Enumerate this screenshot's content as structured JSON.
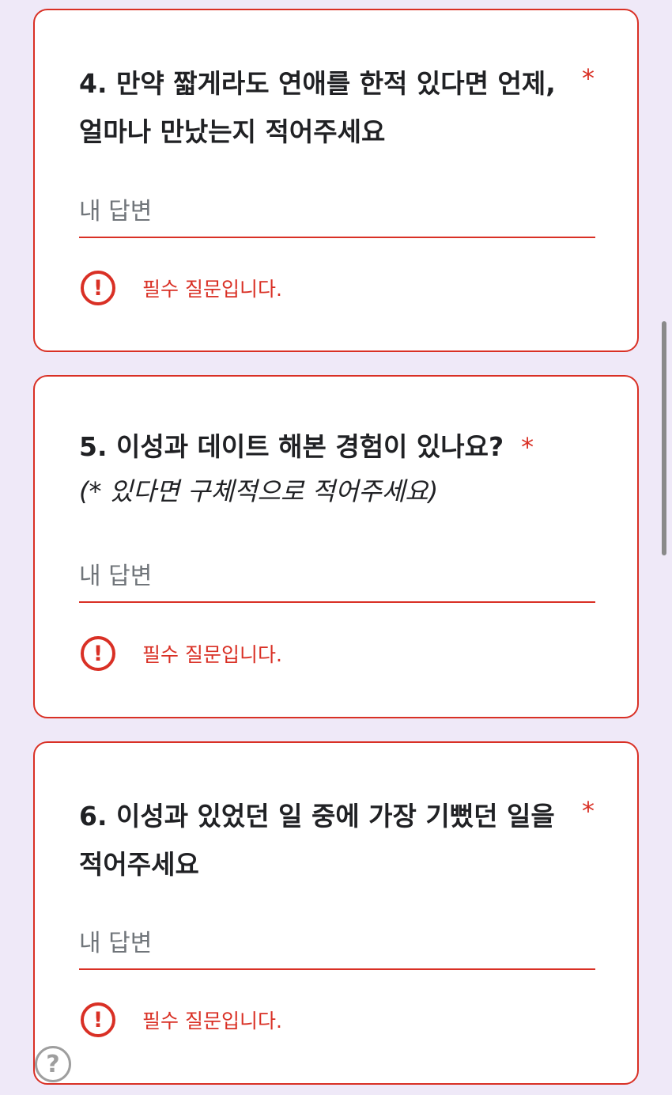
{
  "questions": [
    {
      "title": "4. 만약 짧게라도 연애를 한적 있다면 언제, 얼마나 만났는지 적어주세요",
      "subtitle": "",
      "required_mark": "*",
      "placeholder": "내 답변",
      "error": "필수 질문입니다."
    },
    {
      "title": "5. 이성과 데이트 해본 경험이 있나요?",
      "subtitle": "(* 있다면 구체적으로 적어주세요)",
      "required_mark": "*",
      "placeholder": "내 답변",
      "error": "필수 질문입니다."
    },
    {
      "title": "6. 이성과 있었던 일 중에 가장 기뻤던 일을 적어주세요",
      "subtitle": "",
      "required_mark": "*",
      "placeholder": "내 답변",
      "error": "필수 질문입니다."
    }
  ],
  "icons": {
    "error": "exclamation-circle-icon",
    "help": "question-circle-icon",
    "error_glyph": "!",
    "help_glyph": "?"
  },
  "colors": {
    "error": "#d93025",
    "background": "#efe9f8",
    "card": "#ffffff",
    "text": "#202124",
    "placeholder": "#70757a"
  }
}
